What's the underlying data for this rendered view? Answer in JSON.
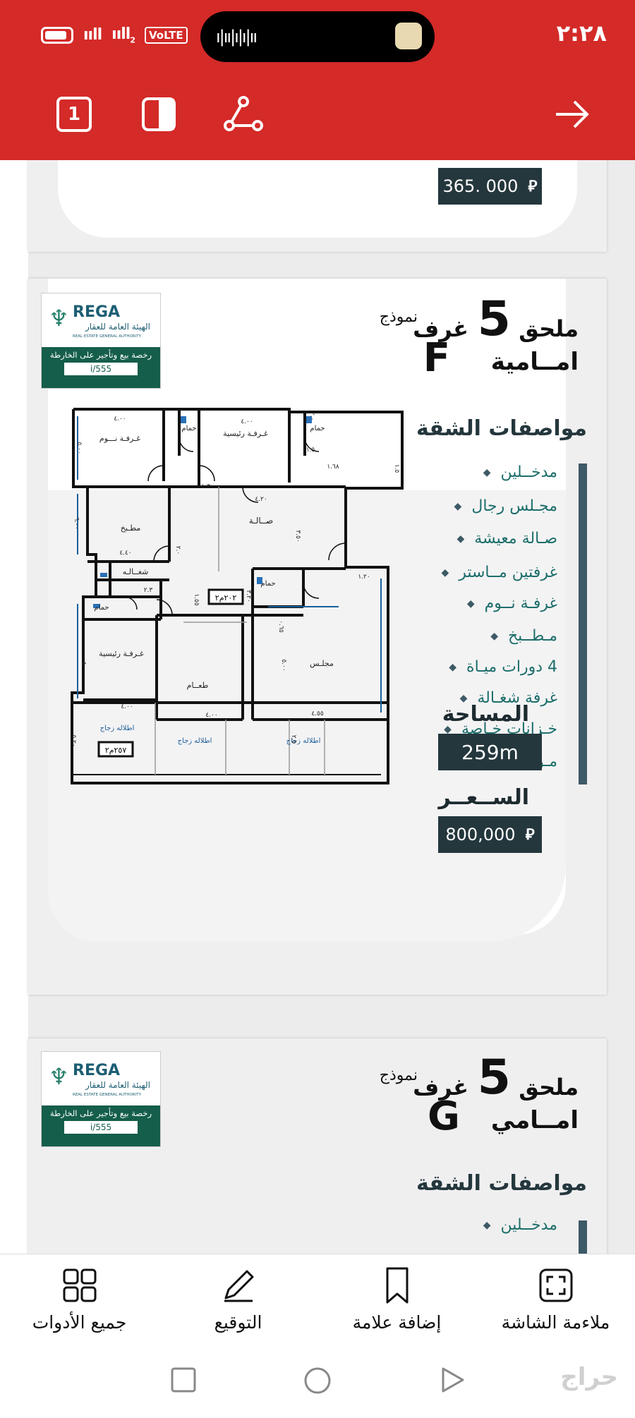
{
  "status_bar": {
    "time": "٢:٢٨",
    "signal_1": "ııll",
    "signal_2": "ııll",
    "sim_index": "2",
    "volte": "VoLTE",
    "wave": "ı|ıı|ı|ı|ıı"
  },
  "toolbar": {
    "page_number": "1"
  },
  "page_top": {
    "price": "365. 000"
  },
  "logo": {
    "brand": "REGA",
    "arabic_name": "الهيئة العامة للعقار",
    "english_name": "REAL ESTATE GENERAL AUTHORITY",
    "license_text": "رخصة بيع وتأجير على الخارطة",
    "license_no": "i/555"
  },
  "unit_f": {
    "title_line1": "ملحق",
    "rooms_number": "5",
    "title_rooms": "غرف",
    "model_word": "نموذج",
    "model_letter": "F",
    "title_line2": "امــامية",
    "specs_title": "مواصفات الشقة",
    "specs": [
      "مدخــلين",
      "مجـلس رجال",
      "صـالة معيشة",
      "غرفتين مــاستر",
      "غرفـة نــوم",
      "مـطــبخ",
      "4 دورات ميـاة",
      "غرفة شغـالة",
      "خـزانات خـاصة",
      "مـوقف خـاص"
    ],
    "area_label": "المساحة",
    "area_value": "259m",
    "price_label": "الســعــر",
    "price": "800,000"
  },
  "floorplan_f": {
    "rooms": {
      "bedroom1": "غـرفـة نـــوم",
      "master1": "غـرفـة رئيسية",
      "bath1": "حمام",
      "bath2": "حمام",
      "hall": "صــالـة",
      "kitchen": "مطـبخ",
      "maid": "شغــالـه",
      "bath3": "حمام",
      "bath4": "حمام",
      "master2": "غـرفـة رئيسية",
      "dining": "طعــام",
      "majlis": "مجلـس",
      "balcony1": "اطلاله زجاج",
      "balcony2": "اطلاله زجاج",
      "balcony3": "اطلاله زجاج"
    },
    "areas": {
      "inner": "٢٠٢م٢",
      "outer": "٢٥٧م٢"
    },
    "dims": [
      "٤.٠٠",
      "٤.٠٠",
      "٤.٢٠",
      "٤.٤٠",
      "٤.٠٠",
      "٤.٠٠",
      "٤.٥٥",
      "٣.٢٠",
      "٥.٠٠",
      "٦.٠٠",
      "٥.٢٠",
      "٥.٠٠",
      "١.٦٨",
      "١.٣٠",
      "١.٢٠",
      "٢.٣",
      "٣.٥٠",
      "١.٥٥",
      "٢.٥",
      "٢.٠",
      "٥.٠",
      "٢.٠",
      "١.٥",
      "٠.٦٥",
      "١.٥"
    ]
  },
  "unit_g": {
    "title_line1": "ملحق",
    "rooms_number": "5",
    "title_rooms": "غرف",
    "model_word": "نموذج",
    "model_letter": "G",
    "title_line2": "امــامي",
    "specs_title": "مواصفات الشقة",
    "first_spec": "مدخــلين"
  },
  "bottom_nav": [
    {
      "label": "ملاءمة الشاشة",
      "icon": "fit-screen-icon"
    },
    {
      "label": "إضافة علامة",
      "icon": "bookmark-icon"
    },
    {
      "label": "التوقيع",
      "icon": "pen-icon"
    },
    {
      "label": "جميع الأدوات",
      "icon": "grid-icon"
    }
  ],
  "watermark": "حراج",
  "colors": {
    "header": "#d42a28",
    "dark_teal": "#24373d",
    "spec_text": "#1c6e6a",
    "rega_green": "#155e4c"
  }
}
